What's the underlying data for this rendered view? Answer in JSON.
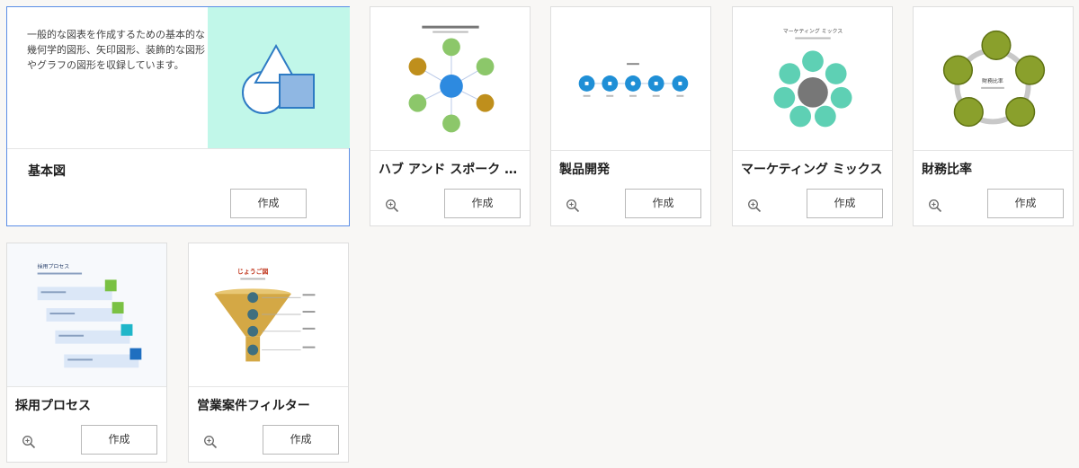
{
  "basic_card": {
    "description": "一般的な図表を作成するための基本的な幾何学的図形、矢印図形、装飾的な図形やグラフの図形を収録しています。",
    "title": "基本図",
    "create_label": "作成"
  },
  "templates": [
    {
      "title": "ハブ アンド スポーク モデル",
      "create_label": "作成"
    },
    {
      "title": "製品開発",
      "create_label": "作成"
    },
    {
      "title": "マーケティング ミックス",
      "create_label": "作成"
    },
    {
      "title": "財務比率",
      "create_label": "作成"
    },
    {
      "title": "採用プロセス",
      "create_label": "作成"
    },
    {
      "title": "営業案件フィルター",
      "create_label": "作成"
    }
  ],
  "thumbnails": {
    "marketing_heading": "マーケティング ミックス",
    "finance_heading": "財務比率",
    "hiring_heading": "採用プロセス",
    "funnel_heading": "じょうご図"
  },
  "icons": {
    "zoom": "zoom-in-icon",
    "basic_shapes": "basic-shapes-icon"
  },
  "colors": {
    "selected_border": "#5b8ee6",
    "basic_art_bg": "#c1f7e9",
    "shape_blue": "#2e7bc4",
    "shape_fill": "#8fb7e3"
  }
}
